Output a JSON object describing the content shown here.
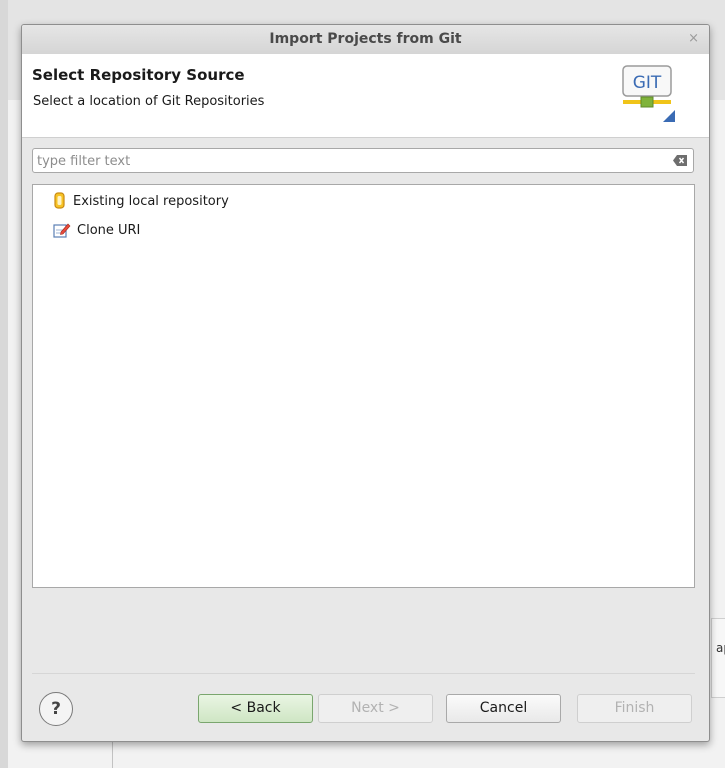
{
  "dialog": {
    "title": "Import Projects from Git",
    "close_symbol": "×"
  },
  "header": {
    "title": "Select Repository Source",
    "subtitle": "Select a location of Git Repositories",
    "logo_text": "GIT"
  },
  "filter": {
    "placeholder": "type filter text",
    "value": ""
  },
  "sources": [
    {
      "label": "Existing local repository",
      "icon": "repository-icon"
    },
    {
      "label": "Clone URI",
      "icon": "clone-uri-icon"
    }
  ],
  "footer": {
    "help_symbol": "?",
    "back_label": "< Back",
    "next_label": "Next >",
    "cancel_label": "Cancel",
    "finish_label": "Finish"
  },
  "background": {
    "partial_text": "ap"
  },
  "colors": {
    "back_button": "#cfe6c4",
    "logo_yellow": "#f0c419",
    "logo_green": "#7fb33a"
  }
}
